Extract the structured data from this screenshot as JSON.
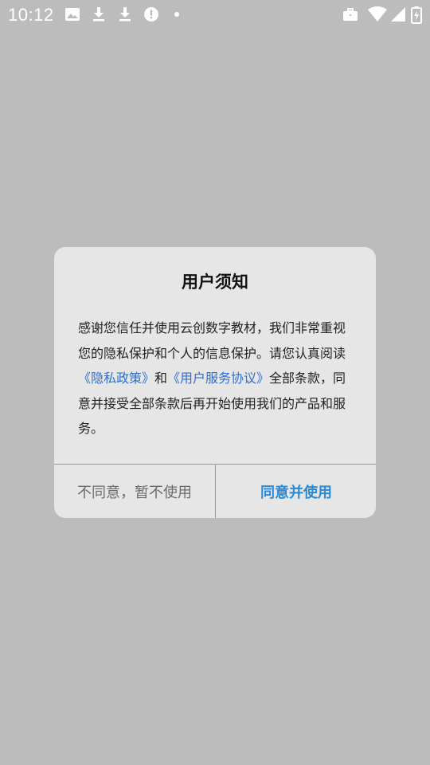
{
  "status_bar": {
    "time": "10:12",
    "left_icons": [
      "image-icon",
      "download-icon",
      "download-icon",
      "alert-icon",
      "dot-icon"
    ],
    "right_icons": [
      "briefcase-icon",
      "wifi-icon",
      "signal-icon",
      "battery-charging-icon"
    ]
  },
  "dialog": {
    "title": "用户须知",
    "body": {
      "text_1": "感谢您信任并使用云创数字教材，我们非常重视您的隐私保护和个人的信息保护。请您认真阅读",
      "link_privacy": "《隐私政策》",
      "text_2": "和",
      "link_agreement": "《用户服务协议》",
      "text_3": "全部条款，同意并接受全部条款后再开始使用我们的产品和服务。"
    },
    "decline_label": "不同意，暂不使用",
    "accept_label": "同意并使用"
  },
  "colors": {
    "overlay": "#bcbcbc",
    "dialog_bg": "#e6e6e6",
    "link": "#2f6fcf",
    "accept": "#2a8ad8",
    "decline": "#6b6b6b"
  }
}
